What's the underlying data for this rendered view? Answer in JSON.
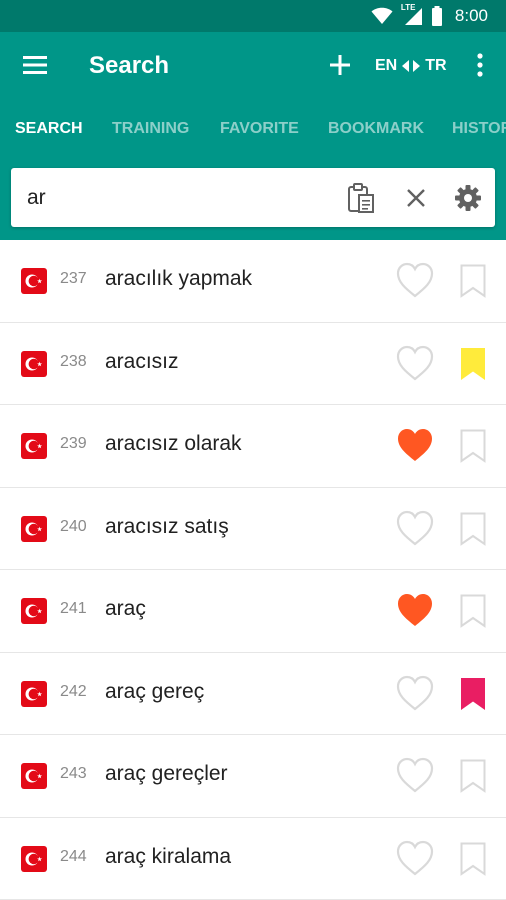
{
  "status_bar": {
    "time": "8:00",
    "icons": [
      "wifi-icon",
      "signal-icon",
      "battery-icon"
    ],
    "network_label": "LTE"
  },
  "app_bar": {
    "title": "Search",
    "language_from": "EN",
    "language_to": "TR",
    "background": "#009688",
    "status_background": "#00796b"
  },
  "tabs": [
    {
      "label": "SEARCH",
      "active": true
    },
    {
      "label": "TRAINING",
      "active": false
    },
    {
      "label": "FAVORITE",
      "active": false
    },
    {
      "label": "BOOKMARK",
      "active": false
    },
    {
      "label": "HISTORY",
      "active": false
    }
  ],
  "search": {
    "value": "ar",
    "placeholder": ""
  },
  "colors": {
    "heart_active": "#ff5722",
    "heart_inactive": "#d9d9d9",
    "bookmark_yellow": "#ffeb3b",
    "bookmark_pink": "#e91e63",
    "bookmark_inactive": "#d9d9d9",
    "flag_red": "#e30a17"
  },
  "results": [
    {
      "num": "237",
      "word": "aracılık yapmak",
      "favorite": false,
      "bookmark": "none"
    },
    {
      "num": "238",
      "word": "aracısız",
      "favorite": false,
      "bookmark": "yellow"
    },
    {
      "num": "239",
      "word": "aracısız olarak",
      "favorite": true,
      "bookmark": "none"
    },
    {
      "num": "240",
      "word": "aracısız satış",
      "favorite": false,
      "bookmark": "none"
    },
    {
      "num": "241",
      "word": "araç",
      "favorite": true,
      "bookmark": "none"
    },
    {
      "num": "242",
      "word": "araç gereç",
      "favorite": false,
      "bookmark": "pink"
    },
    {
      "num": "243",
      "word": "araç gereçler",
      "favorite": false,
      "bookmark": "none"
    },
    {
      "num": "244",
      "word": "araç kiralama",
      "favorite": false,
      "bookmark": "none"
    }
  ]
}
